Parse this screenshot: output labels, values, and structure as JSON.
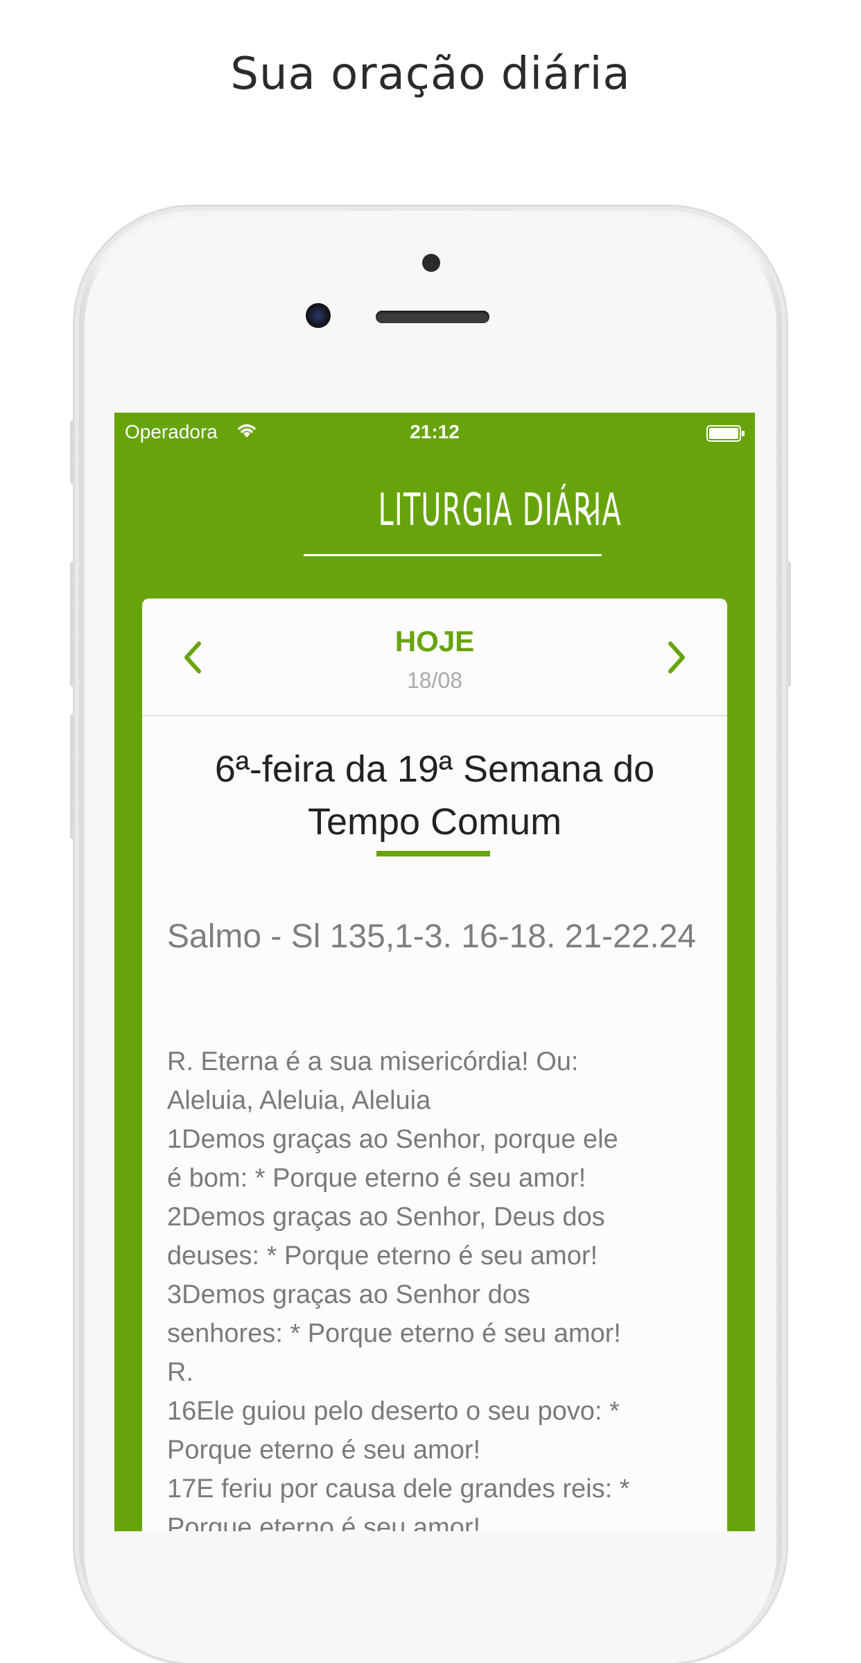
{
  "headline": "Sua oração diária",
  "status_bar": {
    "carrier": "Operadora",
    "time": "21:12",
    "wifi_icon": "wifi-icon",
    "battery_icon": "battery-icon"
  },
  "header": {
    "app_title": "LITURGIA DIÁRIA",
    "dropdown_icon": "chevron-down-icon"
  },
  "day_nav": {
    "label": "HOJE",
    "date": "18/08",
    "prev_icon": "chevron-left-icon",
    "next_icon": "chevron-right-icon"
  },
  "content": {
    "feast_line1": "6ª-feira da 19ª Semana do",
    "feast_line2": "Tempo Comum",
    "reading_title": "Salmo - Sl 135,1-3. 16-18. 21-22.24",
    "lines": [
      "R. Eterna é a sua misericórdia! Ou:",
      "Aleluia, Aleluia, Aleluia",
      "1Demos graças ao Senhor, porque ele",
      "é bom: * Porque eterno é seu amor!",
      "2Demos graças ao Senhor, Deus dos",
      "deuses: * Porque eterno é seu amor!",
      "3Demos graças ao Senhor dos",
      "senhores: * Porque eterno é seu amor!",
      "R.",
      "16Ele guiou pelo deserto o seu povo: *",
      "Porque eterno é seu amor!",
      "17E feriu por causa dele grandes reis: *",
      "Porque eterno é seu amor!"
    ]
  },
  "colors": {
    "accent": "#67a40b",
    "card_bg": "#fcfcfc",
    "text_dark": "#222222",
    "text_gray": "#7a7a7a"
  }
}
